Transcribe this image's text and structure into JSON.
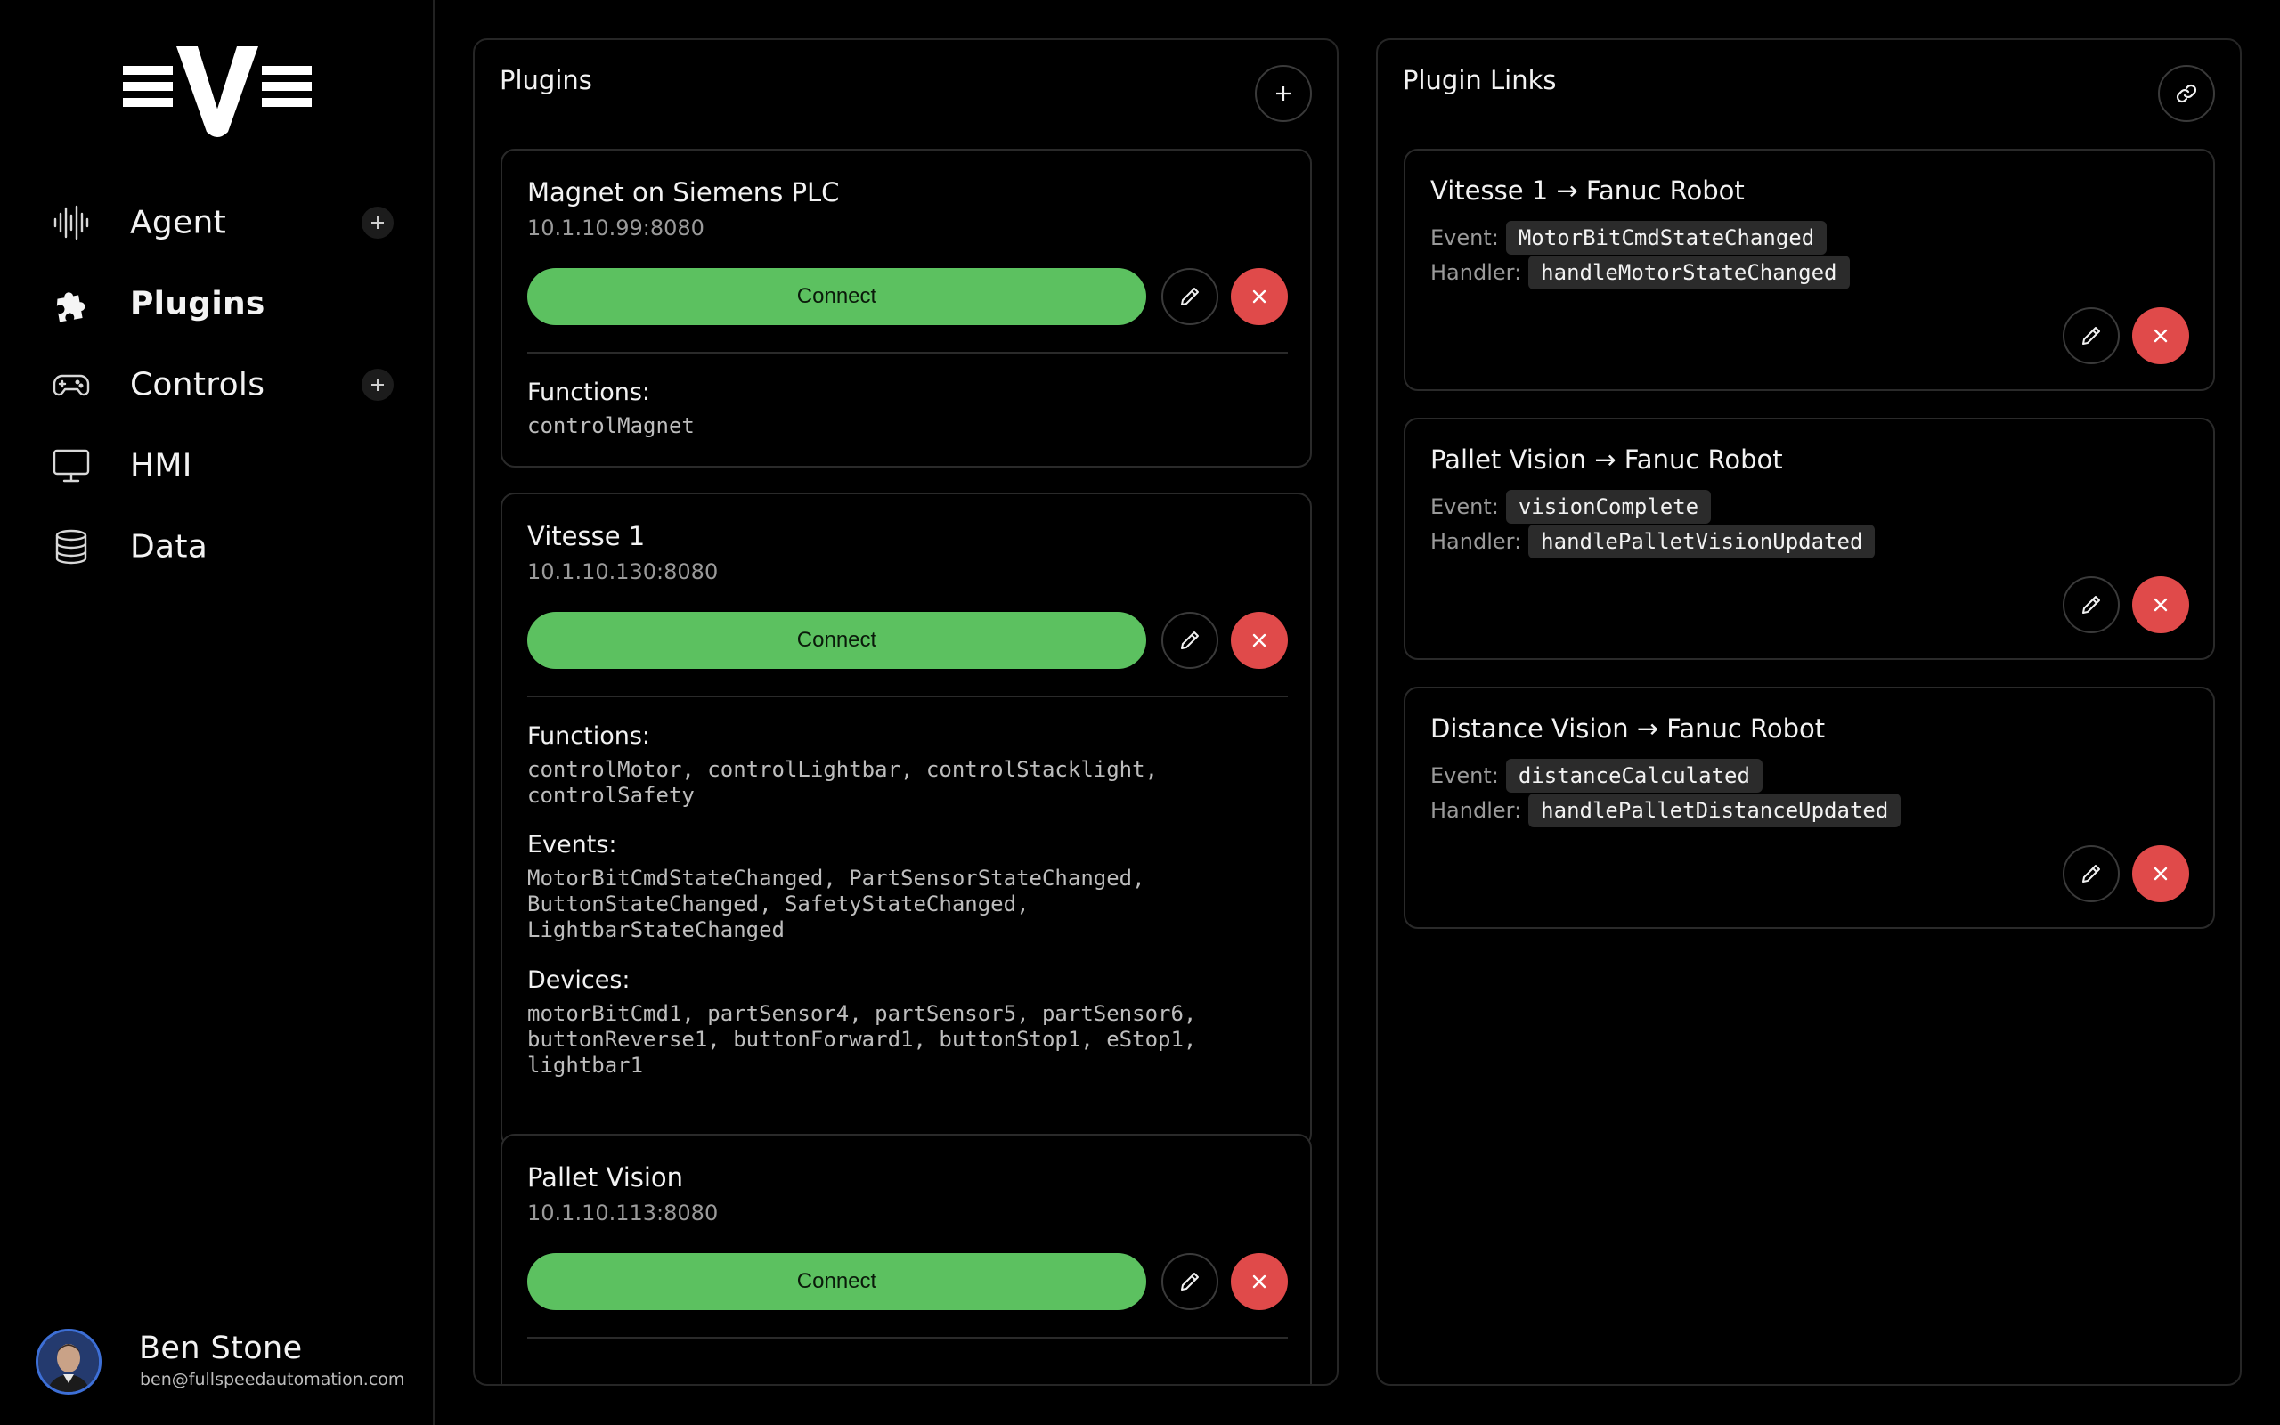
{
  "sidebar": {
    "nav": [
      {
        "label": "Agent",
        "icon": "waveform-icon",
        "has_add": true,
        "active": false
      },
      {
        "label": "Plugins",
        "icon": "puzzle-icon",
        "has_add": false,
        "active": true
      },
      {
        "label": "Controls",
        "icon": "gamepad-icon",
        "has_add": true,
        "active": false
      },
      {
        "label": "HMI",
        "icon": "monitor-icon",
        "has_add": false,
        "active": false
      },
      {
        "label": "Data",
        "icon": "database-icon",
        "has_add": false,
        "active": false
      }
    ],
    "user": {
      "name": "Ben Stone",
      "email": "ben@fullspeedautomation.com"
    }
  },
  "plugins_panel": {
    "title": "Plugins",
    "connect_label": "Connect",
    "functions_label": "Functions:",
    "events_label": "Events:",
    "devices_label": "Devices:",
    "cards": [
      {
        "name": "Magnet on Siemens PLC",
        "address": "10.1.10.99:8080",
        "functions": "controlMagnet"
      },
      {
        "name": "Vitesse 1",
        "address": "10.1.10.130:8080",
        "functions": "controlMotor, controlLightbar, controlStacklight,\ncontrolSafety",
        "events": "MotorBitCmdStateChanged, PartSensorStateChanged,\nButtonStateChanged, SafetyStateChanged,\nLightbarStateChanged",
        "devices": "motorBitCmd1, partSensor4, partSensor5, partSensor6,\nbuttonReverse1, buttonForward1, buttonStop1, eStop1,\nlightbar1"
      },
      {
        "name": "Pallet Vision",
        "address": "10.1.10.113:8080"
      }
    ]
  },
  "links_panel": {
    "title": "Plugin Links",
    "event_label": "Event:",
    "handler_label": "Handler:",
    "links": [
      {
        "title": "Vitesse 1 → Fanuc Robot",
        "event": "MotorBitCmdStateChanged",
        "handler": "handleMotorStateChanged"
      },
      {
        "title": "Pallet Vision → Fanuc Robot",
        "event": "visionComplete",
        "handler": "handlePalletVisionUpdated"
      },
      {
        "title": "Distance Vision → Fanuc Robot",
        "event": "distanceCalculated",
        "handler": "handlePalletDistanceUpdated"
      }
    ]
  },
  "colors": {
    "accent_green": "#5cc160",
    "danger_red": "#e04a4a",
    "background": "#000000"
  }
}
